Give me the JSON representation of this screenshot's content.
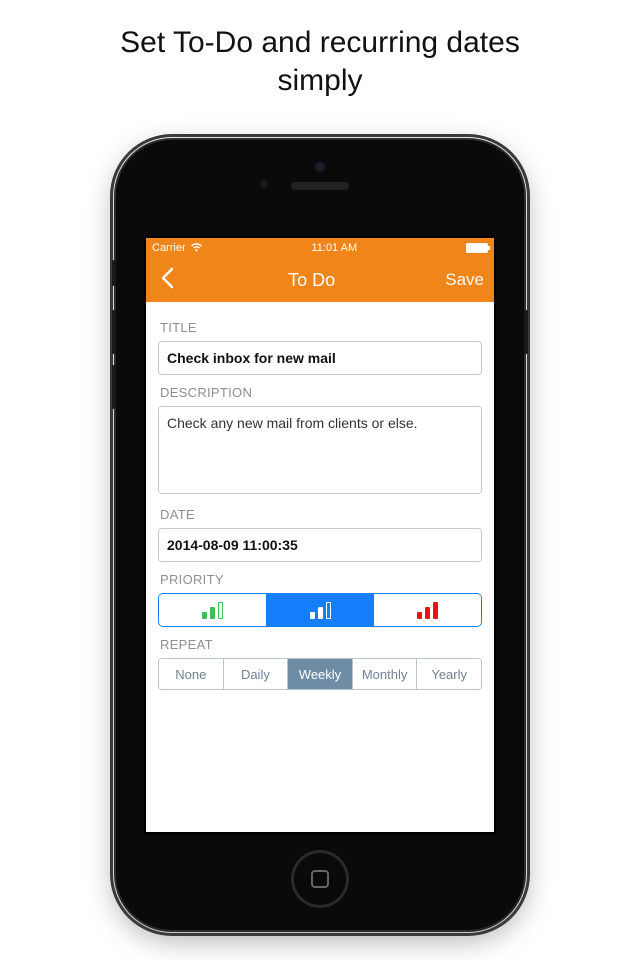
{
  "promo": {
    "line1": "Set To-Do and recurring dates",
    "line2": "simply"
  },
  "status": {
    "carrier": "Carrier",
    "time": "11:01 AM"
  },
  "nav": {
    "title": "To Do",
    "save": "Save"
  },
  "sections": {
    "title_label": "TITLE",
    "description_label": "DESCRIPTION",
    "date_label": "DATE",
    "priority_label": "PRIORITY",
    "repeat_label": "REPEAT"
  },
  "form": {
    "title_value": "Check inbox for new mail",
    "description_value": "Check any new mail from clients or else.",
    "date_value": "2014-08-09 11:00:35"
  },
  "priority": {
    "selected_index": 1,
    "options": [
      "low",
      "medium",
      "high"
    ]
  },
  "repeat": {
    "selected_index": 2,
    "options": [
      "None",
      "Daily",
      "Weekly",
      "Monthly",
      "Yearly"
    ]
  },
  "colors": {
    "accent": "#F08519",
    "ios_blue": "#157EFB",
    "muted_blue": "#6E8CA4"
  }
}
